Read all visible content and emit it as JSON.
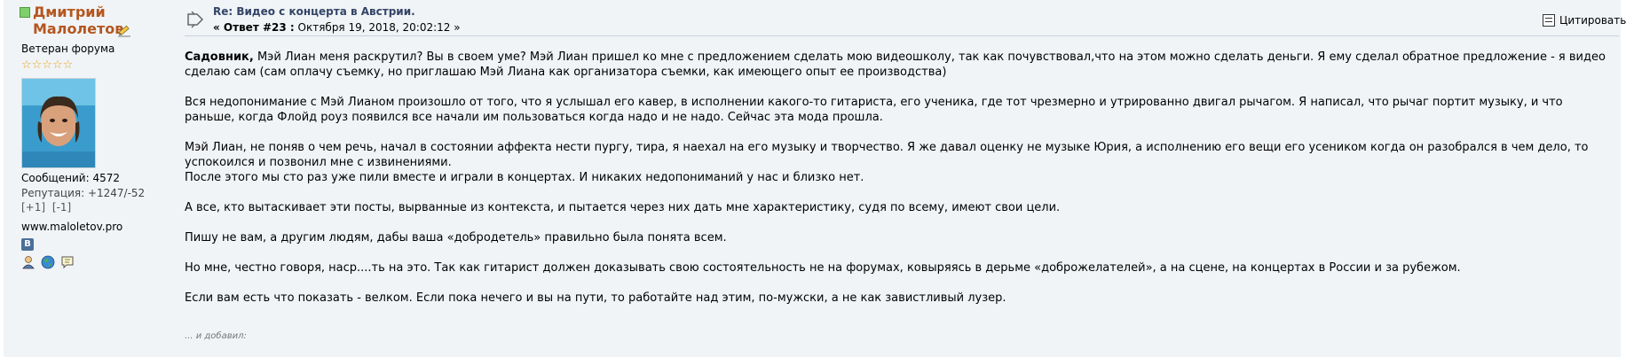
{
  "poster": {
    "name": "Дмитрий Малолетов",
    "group": "Ветеран форума",
    "stars": "☆☆☆☆☆",
    "posts": "Сообщений: 4572",
    "reputation": "Репутация: +1247/-52",
    "karma_plus": "[+1]",
    "karma_minus": "[-1]",
    "website": "www.maloletov.pro",
    "vk_icon": "В"
  },
  "post": {
    "subject": "Re: Видео с концерта в Австрии.",
    "reply_label": "« Ответ #23 :",
    "date": "Октября 19, 2018, 20:02:12 »",
    "quote_label": "Цитировать",
    "addressee": "Садовник,",
    "paragraphs": [
      "Мэй Лиан меня раскрутил? Вы в своем уме? Мэй Лиан пришел ко мне с предложением сделать мою видеошколу, так как почувствовал,что на этом можно сделать деньги. Я ему сделал обратное предложение - я видео сделаю сам (сам оплачу съемку, но приглашаю Мэй Лиана как организатора съемки, как имеющего опыт ее производства)",
      "Вся недопонимание с Мэй Лианом произошло от того, что я услышал его кавер, в исполнении какого-то гитариста, его ученика, где тот чрезмерно и утрированно двигал рычагом. Я написал, что рычаг портит музыку,  и что раньше, когда Флойд роуз появился все начали им пользоваться когда надо и не надо. Сейчас эта мода прошла.",
      "Мэй Лиан, не поняв о чем речь, начал в состоянии аффекта нести  пургу, тира, я наехал на его музыку и творчество. Я же давал оценку не музыке Юрия, а исполнению его вещи его усеником когда он разобрался в чем дело, то успокоился и позвонил мне с извинениями.",
      "После этого мы сто раз уже пили вместе и играли в концертах. И никаких недопониманий у нас и близко нет.",
      "А все, кто вытаскивает эти посты, вырванные из контекста, и пытается через них дать мне характеристику, судя по всему, имеют свои цели.",
      "Пишу не вам, а другим людям, дабы ваша «добродетель» правильно была понята всем.",
      "Но мне, честно говоря, наср....ть на это. Так как гитарист должен доказывать свою состоятельность не на форумах, ковыряясь в дерьме «доброжелателей», а на сцене, на концертах в России и за рубежом.",
      "Если вам есть что показать - велком. Если пока нечего и вы на пути, то работайте над этим, по-мужски, а не как завистливый лузер."
    ],
    "added_note": "... и добавил:"
  }
}
